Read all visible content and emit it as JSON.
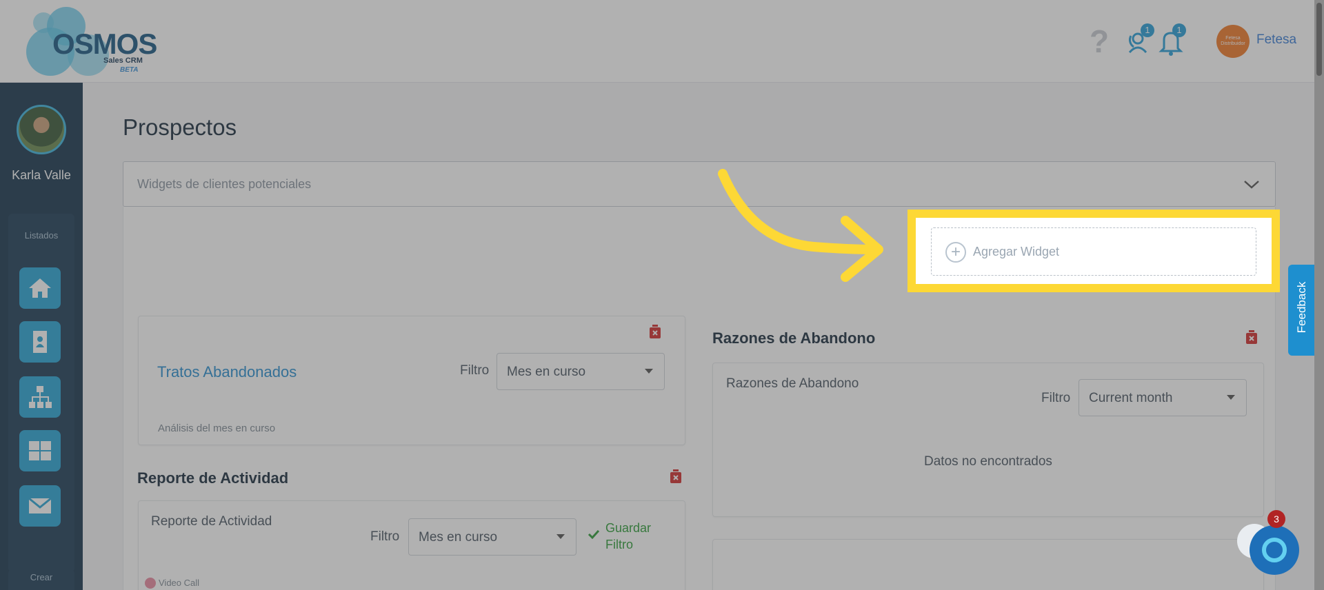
{
  "header": {
    "logo": {
      "brand": "OSMOS",
      "subtitle": "Sales CRM",
      "tag": "BETA"
    },
    "notifications": {
      "contacts_count": "1",
      "alerts_count": "1"
    },
    "company_chip": "Fetesa Distribuidor",
    "company_name": "Fetesa"
  },
  "sidebar": {
    "user_name": "Karla Valle",
    "section_label": "Listados",
    "nav_items": [
      "home-icon",
      "contact-card-icon",
      "hierarchy-icon",
      "grid-icon",
      "envelope-icon"
    ],
    "create_label": "Crear"
  },
  "main": {
    "page_title": "Prospectos",
    "accordion_label": "Widgets de clientes potenciales",
    "add_widget_label": "Agregar Widget",
    "tratos": {
      "title": "Tratos Abandonados",
      "filter_label": "Filtro",
      "filter_value": "Mes en curso",
      "note": "Análisis del mes en curso"
    },
    "razones": {
      "section_title": "Razones de Abandono",
      "card_title": "Razones de Abandono",
      "filter_label": "Filtro",
      "filter_value": "Current month",
      "empty_text": "Datos no encontrados"
    },
    "reporte": {
      "section_title": "Reporte de Actividad",
      "card_title": "Reporte de Actividad",
      "filter_label": "Filtro",
      "filter_value": "Mes en curso",
      "save_filter": "Guardar Filtro",
      "legend_item": "Video Call"
    }
  },
  "widgets": {
    "feedback_label": "Feedback",
    "chat_badge": "3"
  },
  "colors": {
    "sidebar_bg": "#1b3850",
    "accent": "#2aa6d6",
    "highlight": "#fdd835",
    "link": "#2a8fd0",
    "danger": "#d32f2f"
  }
}
